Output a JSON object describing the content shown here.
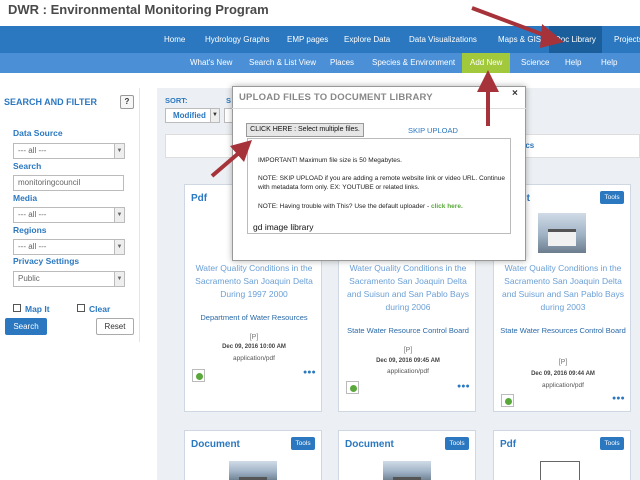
{
  "site": {
    "title": "DWR : Environmental Monitoring Program"
  },
  "main_nav": {
    "items": [
      "Home",
      "Hydrology Graphs",
      "EMP pages",
      "Explore Data",
      "Data Visualizations",
      "Maps & GIS",
      "Doc Library",
      "Projects"
    ],
    "active": "Doc Library"
  },
  "sub_nav": {
    "items": [
      "What's New",
      "Search & List View",
      "Places",
      "Species & Environment",
      "Add New",
      "Science",
      "Help",
      "Help"
    ],
    "highlight": "Add New"
  },
  "sidebar": {
    "title": "SEARCH AND FILTER",
    "help": "?",
    "data_source_label": "Data Source",
    "data_source_value": "--- all ---",
    "search_label": "Search",
    "search_value": "monitoringcouncil",
    "media_label": "Media",
    "media_value": "--- all ---",
    "regions_label": "Regions",
    "regions_value": "--- all ---",
    "privacy_label": "Privacy Settings",
    "privacy_value": "Public",
    "map_it_label": "Map It",
    "clear_label": "Clear",
    "search_button": "Search",
    "reset_button": "Reset"
  },
  "sort": {
    "label": "SORT:",
    "second_label": "S",
    "value": "Modified"
  },
  "tab": {
    "docs_label": "c Docs"
  },
  "modal": {
    "title": "UPLOAD FILES TO DOCUMENT LIBRARY",
    "close": "×",
    "choose_button": "CLICK HERE : Select multiple files.",
    "skip_upload": "SKIP UPLOAD",
    "note_1": "IMPORTANT! Maximum file size is 50 Megabytes.",
    "note_2": "NOTE: SKIP UPLOAD if you are adding a remote website link or video URL. Continue with metadata form only. EX: YOUTUBE or related links.",
    "note_3_prefix": "NOTE: Having trouble with This? Use the default uploader - ",
    "note_3_link": "click here.",
    "gd_label": "gd image library"
  },
  "cards": [
    {
      "type": "Pdf",
      "tools": "Tools",
      "title": "Water Quality Conditions in the Sacramento San Joaquin Delta During 1997 2000",
      "org": "Department of Water Resources",
      "p": "[P]",
      "date": "Dec 09, 2016 10:00 AM",
      "mime": "application/pdf"
    },
    {
      "type": "",
      "tools": "",
      "title": "Water Quality Conditions in the Sacramento San Joaquin Delta and Suisun and San Pablo Bays during 2006",
      "org": "State Water Resource Control Board",
      "p": "[P]",
      "date": "Dec 09, 2016 09:45 AM",
      "mime": "application/pdf"
    },
    {
      "type": "ument",
      "tools": "Tools",
      "title": "Water Quality Conditions in the Sacramento San Joaquin Delta and Suisun and San Pablo Bays during 2003",
      "org": "State Water Resources Control Board",
      "p": "[P]",
      "date": "Dec 09, 2016 09:44 AM",
      "mime": "application/pdf"
    },
    {
      "type": "Document",
      "tools": "Tools"
    },
    {
      "type": "Document",
      "tools": "Tools"
    },
    {
      "type": "Pdf",
      "tools": "Tools"
    }
  ],
  "colors": {
    "nav": "#2b78c0",
    "subnav": "#4b8fd6",
    "highlight": "#a2c83c",
    "arrow": "#a6333a"
  }
}
